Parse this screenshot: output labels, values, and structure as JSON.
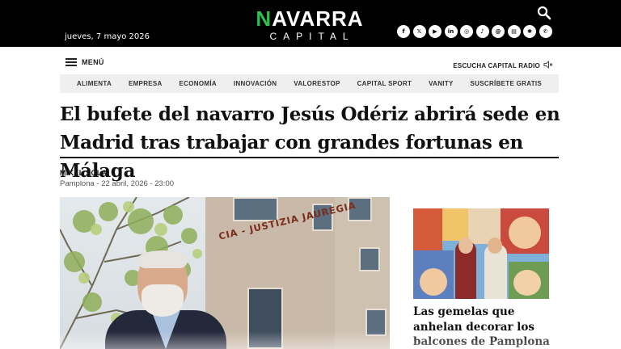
{
  "header": {
    "date": "jueves, 7 mayo 2026",
    "logo": {
      "main_accent": "N",
      "main_rest": "AVARRA",
      "sub": "CAPITAL",
      "accent_color": "#2fbf4a"
    },
    "search_icon": "search-icon",
    "socials": [
      {
        "icon": "facebook-icon",
        "glyph": "f"
      },
      {
        "icon": "x-icon",
        "glyph": "𝕏"
      },
      {
        "icon": "youtube-icon",
        "glyph": "▶"
      },
      {
        "icon": "linkedin-icon",
        "glyph": "in"
      },
      {
        "icon": "instagram-icon",
        "glyph": "◎"
      },
      {
        "icon": "tiktok-icon",
        "glyph": "♪"
      },
      {
        "icon": "threads-icon",
        "glyph": "@"
      },
      {
        "icon": "ivoox-icon",
        "glyph": "▤"
      },
      {
        "icon": "spotify-icon",
        "glyph": "✱"
      },
      {
        "icon": "whatsapp-icon",
        "glyph": "✆"
      }
    ]
  },
  "menu": {
    "label": "MENÚ",
    "radio_label": "ESCUCHA CAPITAL RADIO",
    "radio_icon": "speaker-icon"
  },
  "nav": {
    "items": [
      "ALIMENTA",
      "EMPRESA",
      "ECONOMÍA",
      "INNOVACIÓN",
      "VALORESTOP",
      "CAPITAL SPORT",
      "VANITY",
      "SUSCRÍBETE GRATIS"
    ]
  },
  "article": {
    "headline": "El bufete del navarro Jesús Odériz abrirá sede en Madrid tras trabajar con grandes fortunas en Málaga",
    "author": "MIKEL SOLA",
    "dateline": "Pamplona - 22 abril, 2026 - 23:00",
    "photo_sign": "CIA - JUSTIZIA JAUREGIA"
  },
  "side_article": {
    "title": "Las gemelas que anhelan decorar los balcones de Pamplona con sus lonas de"
  }
}
